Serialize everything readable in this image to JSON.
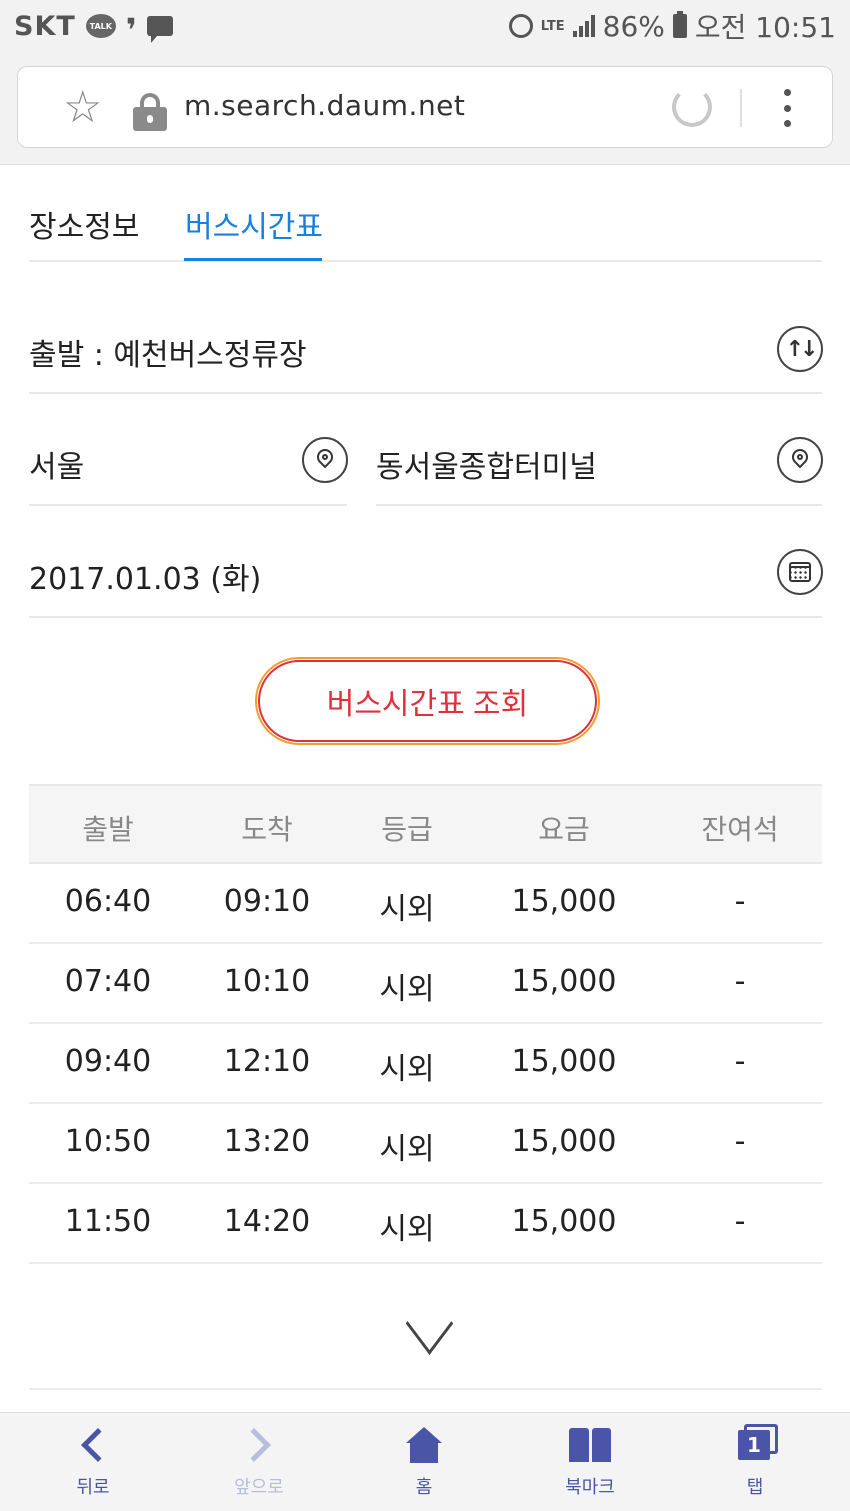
{
  "status_bar": {
    "carrier": "SKT",
    "talk_badge": "TALK",
    "network": "LTE",
    "battery": "86%",
    "time": "오전 10:51"
  },
  "browser": {
    "url": "m.search.daum.net"
  },
  "tabs": [
    {
      "label": "장소정보",
      "active": false
    },
    {
      "label": "버스시간표",
      "active": true
    }
  ],
  "route": {
    "departure": "출발 : 예천버스정류장",
    "city": "서울",
    "terminal": "동서울종합터미널",
    "date": "2017.01.03 (화)",
    "search_button": "버스시간표 조회"
  },
  "table": {
    "headers": [
      "출발",
      "도착",
      "등급",
      "요금",
      "잔여석"
    ],
    "rows": [
      [
        "06:40",
        "09:10",
        "시외",
        "15,000",
        "-"
      ],
      [
        "07:40",
        "10:10",
        "시외",
        "15,000",
        "-"
      ],
      [
        "09:40",
        "12:10",
        "시외",
        "15,000",
        "-"
      ],
      [
        "10:50",
        "13:20",
        "시외",
        "15,000",
        "-"
      ],
      [
        "11:50",
        "14:20",
        "시외",
        "15,000",
        "-"
      ]
    ]
  },
  "bottom_nav": {
    "back": "뒤로",
    "forward": "앞으로",
    "home": "홈",
    "bookmark": "북마크",
    "tabs": "탭",
    "tab_count": "1"
  },
  "colors": {
    "accent_blue": "#1a7fe0",
    "button_red": "#e0303a",
    "nav_purple": "#4a55a8"
  },
  "icons": [
    "star-icon",
    "lock-icon",
    "reload-icon",
    "menu-icon",
    "swap-icon",
    "location-pin-icon",
    "calendar-icon",
    "chevron-down-icon",
    "back-icon",
    "forward-icon",
    "home-icon",
    "bookmark-icon",
    "tabs-icon"
  ]
}
